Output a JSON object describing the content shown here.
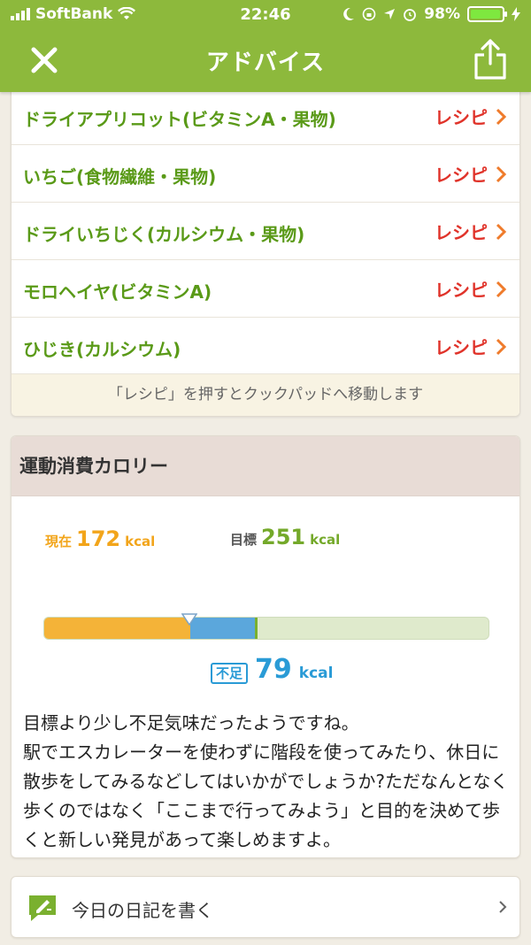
{
  "status_bar": {
    "carrier": "SoftBank",
    "time": "22:46",
    "battery": "98%"
  },
  "nav": {
    "title": "アドバイス",
    "close_icon": "close-icon",
    "share_icon": "share-icon"
  },
  "recipes": {
    "items": [
      {
        "name": "ドライアプリコット(ビタミンA・果物)",
        "link": "レシピ"
      },
      {
        "name": "いちご(食物繊維・果物)",
        "link": "レシピ"
      },
      {
        "name": "ドライいちじく(カルシウム・果物)",
        "link": "レシピ"
      },
      {
        "name": "モロヘイヤ(ビタミンA)",
        "link": "レシピ"
      },
      {
        "name": "ひじき(カルシウム)",
        "link": "レシピ"
      }
    ],
    "note": "「レシピ」を押すとクックパッドへ移動します"
  },
  "calorie": {
    "title": "運動消費カロリー",
    "current_label": "現在",
    "current_value": "172",
    "target_label": "目標",
    "target_value": "251",
    "unit": "kcal",
    "deficit_label": "不足",
    "deficit_value": "79",
    "current_kcal": 172,
    "target_kcal": 251,
    "bar_max_kcal": 525,
    "advice": "目標より少し不足気味だったようですね。\n駅でエスカレーターを使わずに階段を使ってみたり、休日に散歩をしてみるなどしてはいかがでしょうか?ただなんとなく歩くのではなく「ここまで行ってみよう」と目的を決めて歩くと新しい発見があって楽しめますよ。",
    "colors": {
      "current": "#f4b338",
      "deficit": "#5ba7dc",
      "target": "#7ab02f",
      "track": "#dfeacc"
    }
  },
  "diary": {
    "label": "今日の日記を書く",
    "icon": "pencil-note-icon"
  }
}
